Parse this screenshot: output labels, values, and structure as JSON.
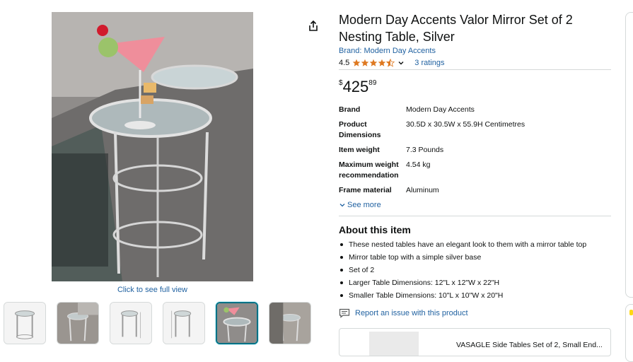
{
  "product": {
    "title": "Modern Day Accents Valor Mirror Set of 2 Nesting Table, Silver",
    "brand_link": "Brand: Modern Day Accents",
    "rating_value": "4.5",
    "rating_stars": 4.5,
    "ratings_count": "3 ratings",
    "price": {
      "currency": "$",
      "whole": "425",
      "fraction": "89"
    }
  },
  "gallery": {
    "see_full_view": "Click to see full view",
    "thumbnail_count": 6,
    "selected_thumbnail": 5
  },
  "specs": [
    {
      "label": "Brand",
      "value": "Modern Day Accents"
    },
    {
      "label": "Product Dimensions",
      "value": "30.5D x 30.5W x 55.9H Centimetres"
    },
    {
      "label": "Item weight",
      "value": "7.3 Pounds"
    },
    {
      "label": "Maximum weight recommendation",
      "value": "4.54 kg"
    },
    {
      "label": "Frame material",
      "value": "Aluminum"
    }
  ],
  "see_more": "See more",
  "about": {
    "heading": "About this item",
    "bullets": [
      "These nested tables have an elegant look to them with a mirror table top",
      "Mirror table top with a simple silver base",
      "Set of 2",
      "Larger Table Dimensions: 12\"L x 12\"W x 22\"H",
      "Smaller Table Dimensions: 10\"L x 10\"W x 20\"H"
    ]
  },
  "report_link": "Report an issue with this product",
  "sponsored": {
    "title": "VASAGLE Side Tables Set of 2, Small End..."
  },
  "colors": {
    "link": "#2162a1",
    "star": "#de7921",
    "text": "#0f1111",
    "divider": "#d5d9d9",
    "selected": "#007185"
  }
}
